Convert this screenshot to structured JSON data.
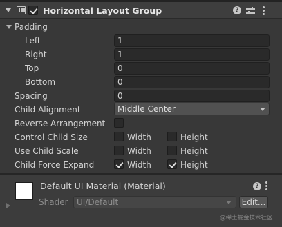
{
  "component": {
    "title": "Horizontal Layout Group",
    "enabled": true
  },
  "padding": {
    "label": "Padding",
    "left_label": "Left",
    "left_value": "1",
    "right_label": "Right",
    "right_value": "1",
    "top_label": "Top",
    "top_value": "0",
    "bottom_label": "Bottom",
    "bottom_value": "0"
  },
  "spacing": {
    "label": "Spacing",
    "value": "0"
  },
  "child_alignment": {
    "label": "Child Alignment",
    "value": "Middle Center"
  },
  "reverse_arrangement": {
    "label": "Reverse Arrangement",
    "checked": false
  },
  "control_child_size": {
    "label": "Control Child Size",
    "width_label": "Width",
    "width_checked": false,
    "height_label": "Height",
    "height_checked": false
  },
  "use_child_scale": {
    "label": "Use Child Scale",
    "width_label": "Width",
    "width_checked": false,
    "height_label": "Height",
    "height_checked": false
  },
  "child_force_expand": {
    "label": "Child Force Expand",
    "width_label": "Width",
    "width_checked": true,
    "height_label": "Height",
    "height_checked": true
  },
  "material": {
    "title": "Default UI Material (Material)",
    "shader_label": "Shader",
    "shader_value": "UI/Default",
    "edit_label": "Edit..."
  },
  "help_icon_glyph": "?",
  "watermark": "@稀土掘金技术社区",
  "icons": {
    "fold": "triangle-down-icon",
    "component": "horizontal-layout-icon",
    "help": "help-icon",
    "presets": "presets-icon",
    "menu": "kebab-menu-icon",
    "material_fold": "triangle-right-icon"
  },
  "colors": {
    "background": "#383838",
    "header": "#3e3e3e",
    "field": "#2a2a2a",
    "dropdown": "#515151",
    "text": "#d2d2d2"
  }
}
